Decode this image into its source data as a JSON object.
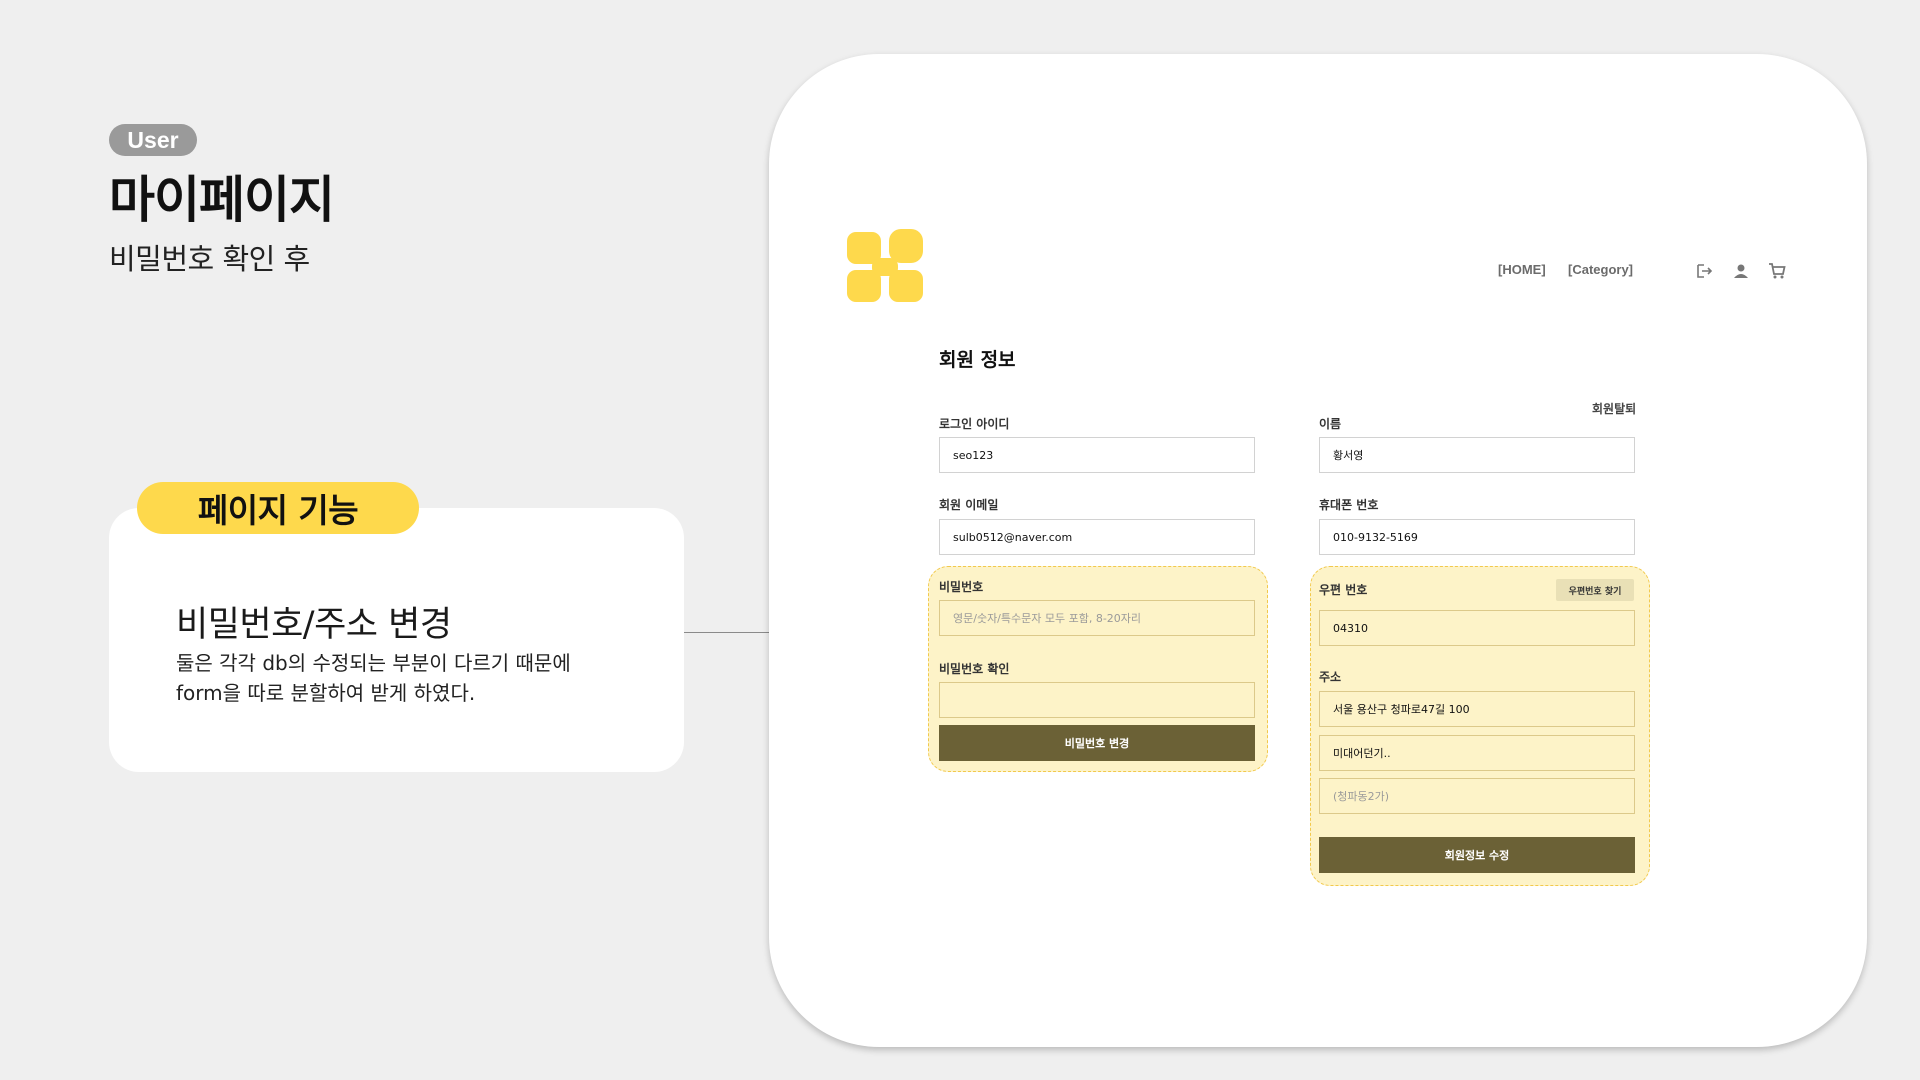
{
  "slide": {
    "tag": "User",
    "title": "마이페이지",
    "subtitle": "비밀번호 확인 후",
    "feature_pill": "페이지 기능",
    "feature_heading": "비밀번호/주소 변경",
    "feature_desc_line1": "둘은 각각 db의 수정되는 부분이 다르기 때문에",
    "feature_desc_line2": "form을 따로 분할하여 받게 하였다."
  },
  "site": {
    "nav": {
      "home": "[HOME]",
      "category": "[Category]"
    },
    "icons": [
      "logout-icon",
      "user-icon",
      "cart-icon"
    ],
    "colors": {
      "brand_yellow": "#fed94c",
      "button_olive": "#6b6136",
      "zone_fill": "#fdf3c8"
    }
  },
  "member": {
    "heading": "회원 정보",
    "withdraw_label": "회원탈퇴",
    "login_id": {
      "label": "로그인 아이디",
      "value": "seo123"
    },
    "name": {
      "label": "이름",
      "value": "황서영"
    },
    "email": {
      "label": "회원 이메일",
      "value": "sulb0512@naver.com"
    },
    "phone": {
      "label": "휴대폰 번호",
      "value": "010-9132-5169"
    }
  },
  "password_form": {
    "password_label": "비밀번호",
    "password_placeholder": "영문/숫자/특수문자 모두 포함, 8-20자리",
    "confirm_label": "비밀번호 확인",
    "confirm_value": "",
    "submit_label": "비밀번호 변경"
  },
  "address_form": {
    "zip_label": "우편 번호",
    "zip_search_label": "우편번호 찾기",
    "zip_value": "04310",
    "address_label": "주소",
    "address_value": "서울 용산구 청파로47길 100",
    "detail_value": "미대어던기..",
    "extra_value": "(청파동2가)",
    "submit_label": "회원정보 수정"
  }
}
